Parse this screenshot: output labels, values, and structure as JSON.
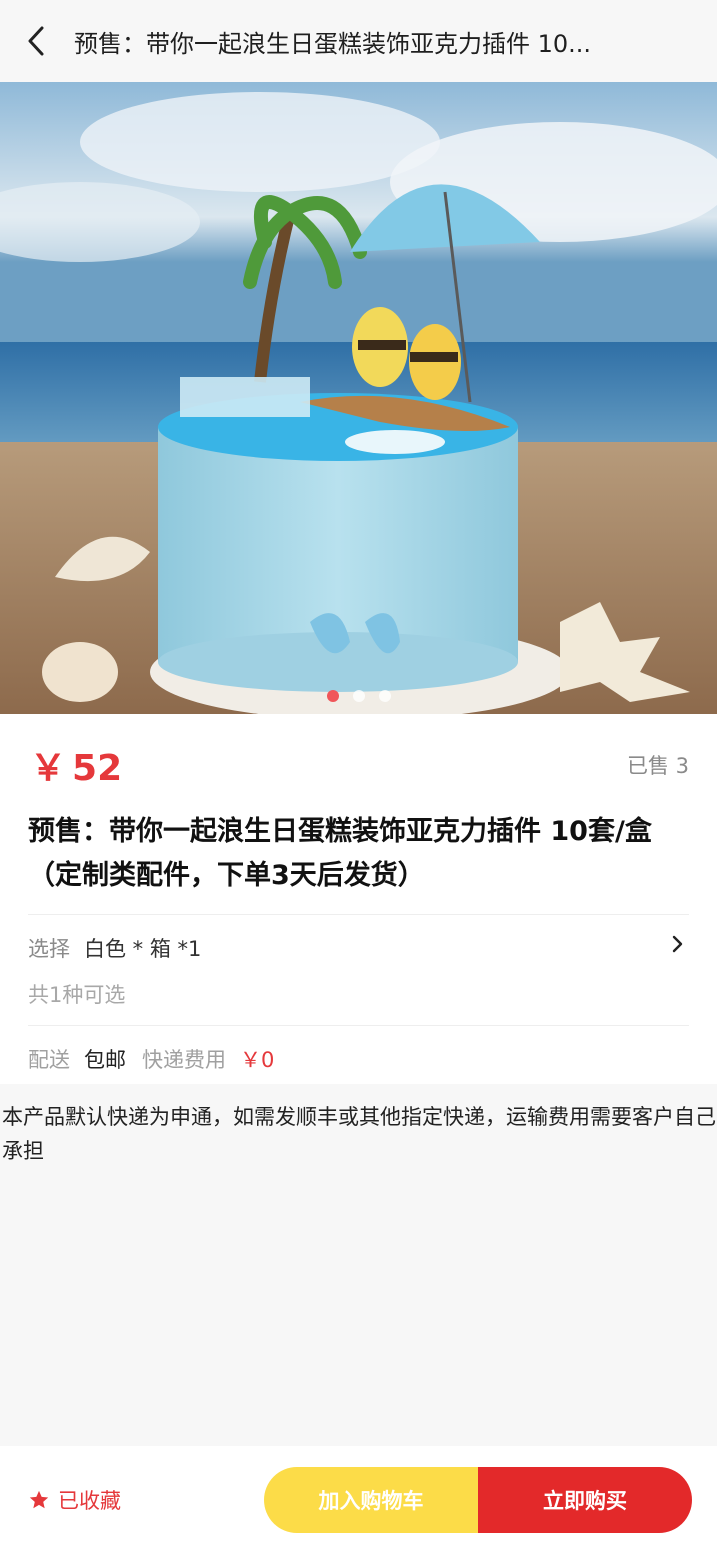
{
  "header": {
    "title": "预售：带你一起浪生日蛋糕装饰亚克力插件 10..."
  },
  "carousel": {
    "dot_count": 3,
    "active_index": 0
  },
  "product": {
    "currency": "￥",
    "price": "52",
    "sold_label": "已售 3",
    "title": "预售：带你一起浪生日蛋糕装饰亚克力插件 10套/盒（定制类配件，下单3天后发货）"
  },
  "spec": {
    "label": "选择",
    "value": "白色 * 箱 *1",
    "sub": "共1种可选"
  },
  "delivery": {
    "label": "配送",
    "value": "包邮",
    "fee_label": "快递费用",
    "fee": "￥0"
  },
  "notice": "本产品默认快递为申通，如需发顺丰或其他指定快递，运输费用需要客户自己承担",
  "bottom": {
    "favorite_label": "已收藏",
    "add_to_cart": "加入购物车",
    "buy_now": "立即购买"
  },
  "colors": {
    "accent": "#e5383b",
    "cart_button": "#fcdc48",
    "buy_button": "#e3292a"
  }
}
